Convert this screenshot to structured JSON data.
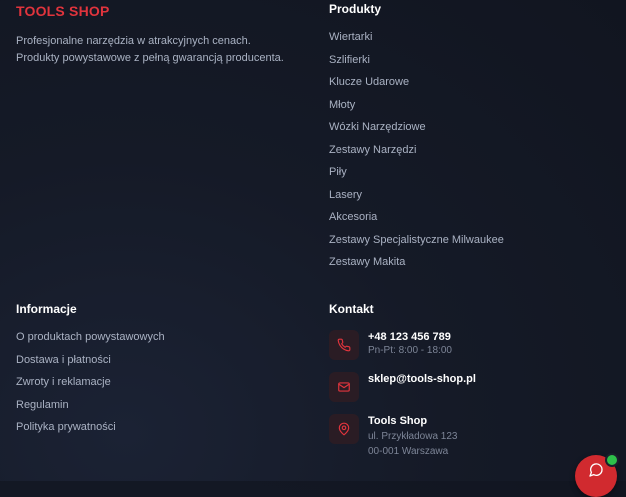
{
  "brand": {
    "name": "TOOLS SHOP",
    "description_line1": "Profesjonalne narzędzia w atrakcyjnych cenach.",
    "description_line2": "Produkty powystawowe z pełną gwarancją producenta."
  },
  "products": {
    "title": "Produkty",
    "items": [
      "Wiertarki",
      "Szlifierki",
      "Klucze Udarowe",
      "Młoty",
      "Wózki Narzędziowe",
      "Zestawy Narzędzi",
      "Piły",
      "Lasery",
      "Akcesoria",
      "Zestawy Specjalistyczne Milwaukee",
      "Zestawy Makita"
    ]
  },
  "info": {
    "title": "Informacje",
    "items": [
      "O produktach powystawowych",
      "Dostawa i płatności",
      "Zwroty i reklamacje",
      "Regulamin",
      "Polityka prywatności"
    ]
  },
  "contact": {
    "title": "Kontakt",
    "phone": "+48 123 456 789",
    "hours": "Pn-Pt: 8:00 - 18:00",
    "email": "sklep@tools-shop.pl",
    "company": "Tools Shop",
    "street": "ul. Przykładowa 123",
    "city": "00-001 Warszawa"
  },
  "icons": {
    "phone": "phone-icon",
    "email": "mail-icon",
    "address": "map-pin-icon",
    "chat": "chat-bubble-icon"
  },
  "colors": {
    "accent": "#e0343d",
    "background": "#151a27",
    "online": "#2ec04a"
  }
}
